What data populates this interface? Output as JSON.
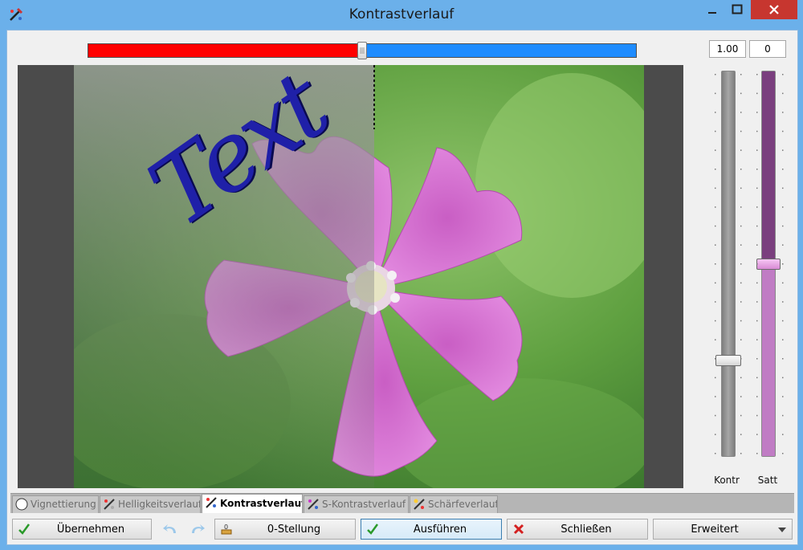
{
  "window": {
    "title": "Kontrastverlauf"
  },
  "top_slider": {
    "value": 0.5,
    "left_color": "#ff0000",
    "right_color": "#1e8cff"
  },
  "value_boxes": {
    "contrast": "1.00",
    "offset": "0"
  },
  "image": {
    "overlay_text": "Text",
    "overlay_text_color": "#1f20a8"
  },
  "side_sliders": {
    "contrast": {
      "label": "Kontr",
      "value": 0.25,
      "color": "#8a8a8a"
    },
    "saturation": {
      "label": "Satt",
      "value": 0.5,
      "color": "#b779bb"
    }
  },
  "tabs": [
    {
      "label": "Vignettierung",
      "icon": "vignette-icon",
      "active": false
    },
    {
      "label": "Helligkeitsverlauf",
      "icon": "brightness-gradient-icon",
      "active": false
    },
    {
      "label": "Kontrastverlauf",
      "icon": "contrast-gradient-icon",
      "active": true
    },
    {
      "label": "S-Kontrastverlauf",
      "icon": "s-contrast-gradient-icon",
      "active": false
    },
    {
      "label": "Schärfeverlauf",
      "icon": "sharpness-gradient-icon",
      "active": false
    }
  ],
  "buttons": {
    "apply": "Übernehmen",
    "reset": "0-Stellung",
    "execute": "Ausführen",
    "close": "Schließen",
    "advanced": "Erweitert"
  }
}
